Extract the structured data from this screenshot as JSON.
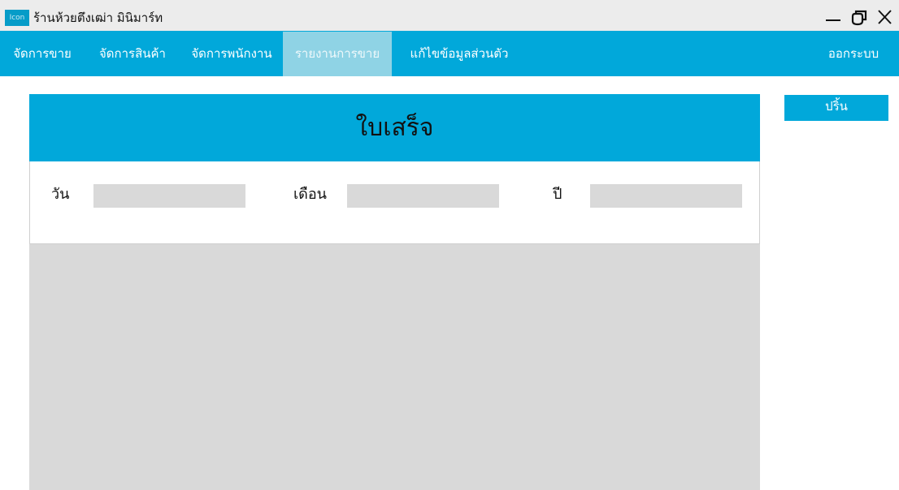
{
  "window": {
    "icon_label": "Icon",
    "title": "ร้านห้วยตึงเฒ่า มินิมาร์ท",
    "controls": [
      "minimize-icon",
      "restore-icon",
      "close-icon"
    ]
  },
  "nav": {
    "items": [
      {
        "label": "จัดการขาย",
        "active": false
      },
      {
        "label": "จัดการสินค้า",
        "active": false
      },
      {
        "label": "จัดการพนักงาน",
        "active": false
      },
      {
        "label": "รายงานการขาย",
        "active": true
      },
      {
        "label": "แก้ไขข้อมูลส่วนตัว",
        "active": false
      }
    ],
    "logout_label": "ออกระบบ"
  },
  "receipt": {
    "title": "ใบเสร็จ",
    "day_label": "วัน",
    "day_value": "",
    "month_label": "เดือน",
    "month_value": "",
    "year_label": "ปี",
    "year_value": ""
  },
  "print_label": "ปริ้น",
  "colors": {
    "accent": "#01a8da",
    "nav_active": "#8fd3e5",
    "titlebar": "#ececec",
    "panel_gray": "#d9d9d9"
  }
}
